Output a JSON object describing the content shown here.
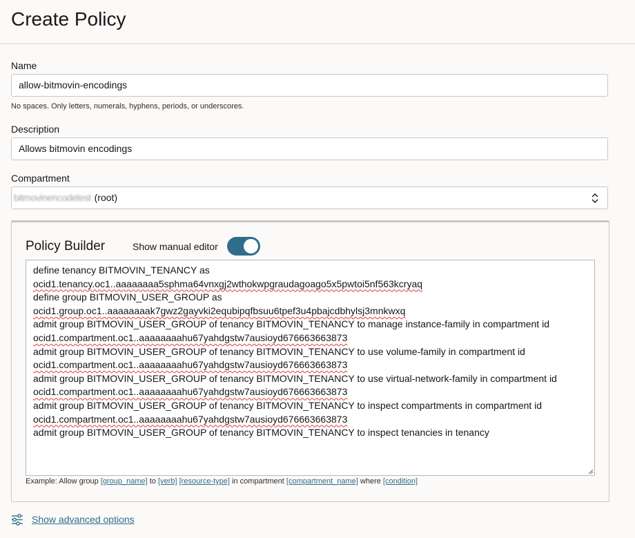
{
  "page": {
    "title": "Create Policy"
  },
  "name_field": {
    "label": "Name",
    "value": "allow-bitmovin-encodings",
    "hint": "No spaces. Only letters, numerals, hyphens, periods, or underscores."
  },
  "description_field": {
    "label": "Description",
    "value": "Allows bitmovin encodings"
  },
  "compartment_field": {
    "label": "Compartment",
    "obscured_name": "bitmovinencodetest",
    "value_suffix": "(root)"
  },
  "policy_builder": {
    "title": "Policy Builder",
    "toggle_label": "Show manual editor",
    "toggle_on": true,
    "lines": [
      "define tenancy BITMOVIN_TENANCY as",
      "ocid1.tenancy.oc1..aaaaaaaa5sphma64vnxgj2wthokwpgraudagoago5x5pwtoi5nf563kcryaq",
      "define group BITMOVIN_USER_GROUP as",
      "ocid1.group.oc1..aaaaaaaak7gwz2gayvki2equbipqfbsuu6tpef3u4pbajcdbhylsj3mnkwxq",
      "admit group BITMOVIN_USER_GROUP of tenancy BITMOVIN_TENANCY to manage instance-family in compartment id",
      "ocid1.compartment.oc1..aaaaaaaahu67yahdgstw7ausioyd676663663873",
      "admit group BITMOVIN_USER_GROUP of tenancy BITMOVIN_TENANCY to use volume-family in compartment id",
      "ocid1.compartment.oc1..aaaaaaaahu67yahdgstw7ausioyd676663663873",
      "admit group BITMOVIN_USER_GROUP of tenancy BITMOVIN_TENANCY to use virtual-network-family in compartment id",
      "ocid1.compartment.oc1..aaaaaaaahu67yahdgstw7ausioyd676663663873",
      "admit group BITMOVIN_USER_GROUP of tenancy BITMOVIN_TENANCY to inspect compartments in compartment id",
      "ocid1.compartment.oc1..aaaaaaaahu67yahdgstw7ausioyd676663663873",
      "admit group BITMOVIN_USER_GROUP of tenancy BITMOVIN_TENANCY to inspect tenancies in tenancy"
    ],
    "example": {
      "prefix": "Example: Allow group ",
      "group_name": "[group_name]",
      "to": " to ",
      "verb": "[verb]",
      "resource_type": "[resource-type]",
      "in_compartment": " in compartment ",
      "compartment_name": "[compartment_name]",
      "where": " where ",
      "condition": "[condition]"
    }
  },
  "advanced": {
    "label": "Show advanced options"
  },
  "colors": {
    "accent": "#2f6d8a",
    "toggle_on": "#2f6d8a",
    "spellcheck": "#e53935"
  },
  "icons": {
    "compartment_select": "chevron-up-down-icon",
    "advanced": "sliders-icon"
  }
}
